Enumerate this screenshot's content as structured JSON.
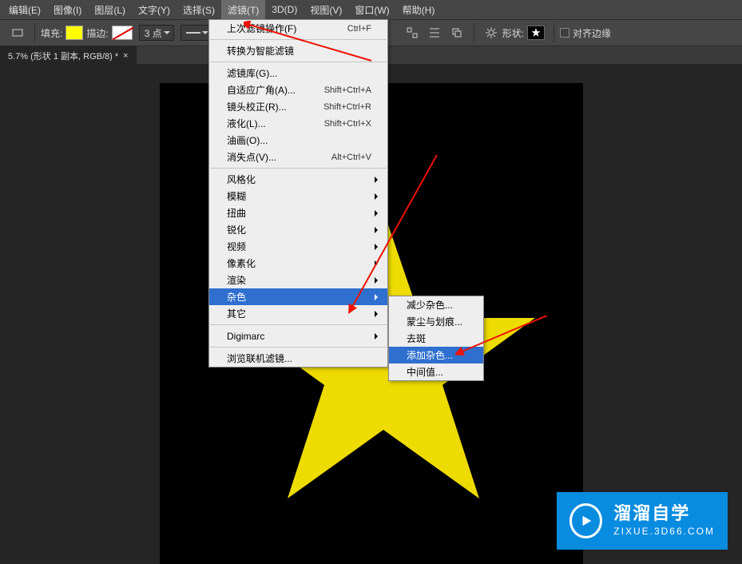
{
  "menubar": [
    "编辑(E)",
    "图像(I)",
    "图层(L)",
    "文字(Y)",
    "选择(S)",
    "滤镜(T)",
    "3D(D)",
    "视图(V)",
    "窗口(W)",
    "帮助(H)"
  ],
  "menubar_active_index": 5,
  "toolbar": {
    "fill_label": "填充:",
    "stroke_label": "描边:",
    "stroke_width": "3 点",
    "shape_label": "形状:",
    "align_label": "对齐边缘"
  },
  "tab": {
    "title": "5.7% (形状 1 副本, RGB/8) *",
    "close": "×"
  },
  "menu1": [
    {
      "t": "item",
      "label": "上次滤镜操作(F)",
      "shortcut": "Ctrl+F"
    },
    {
      "t": "sep"
    },
    {
      "t": "item",
      "label": "转换为智能滤镜"
    },
    {
      "t": "sep"
    },
    {
      "t": "item",
      "label": "滤镜库(G)..."
    },
    {
      "t": "item",
      "label": "自适应广角(A)...",
      "shortcut": "Shift+Ctrl+A"
    },
    {
      "t": "item",
      "label": "镜头校正(R)...",
      "shortcut": "Shift+Ctrl+R"
    },
    {
      "t": "item",
      "label": "液化(L)...",
      "shortcut": "Shift+Ctrl+X"
    },
    {
      "t": "item",
      "label": "油画(O)..."
    },
    {
      "t": "item",
      "label": "消失点(V)...",
      "shortcut": "Alt+Ctrl+V"
    },
    {
      "t": "sep"
    },
    {
      "t": "item",
      "label": "风格化",
      "sub": true
    },
    {
      "t": "item",
      "label": "模糊",
      "sub": true
    },
    {
      "t": "item",
      "label": "扭曲",
      "sub": true
    },
    {
      "t": "item",
      "label": "锐化",
      "sub": true
    },
    {
      "t": "item",
      "label": "视频",
      "sub": true
    },
    {
      "t": "item",
      "label": "像素化",
      "sub": true
    },
    {
      "t": "item",
      "label": "渲染",
      "sub": true
    },
    {
      "t": "item",
      "label": "杂色",
      "sub": true,
      "hl": true
    },
    {
      "t": "item",
      "label": "其它",
      "sub": true
    },
    {
      "t": "sep"
    },
    {
      "t": "item",
      "label": "Digimarc",
      "sub": true
    },
    {
      "t": "sep"
    },
    {
      "t": "item",
      "label": "浏览联机滤镜..."
    }
  ],
  "menu2": [
    {
      "label": "减少杂色..."
    },
    {
      "label": "蒙尘与划痕..."
    },
    {
      "label": "去斑"
    },
    {
      "label": "添加杂色...",
      "hl": true
    },
    {
      "label": "中间值..."
    }
  ],
  "watermark": {
    "title": "溜溜自学",
    "url": "ZIXUE.3D66.COM"
  },
  "colors": {
    "star": "#eedb00",
    "highlight": "#2f6fcf",
    "brand": "#088ce0"
  }
}
